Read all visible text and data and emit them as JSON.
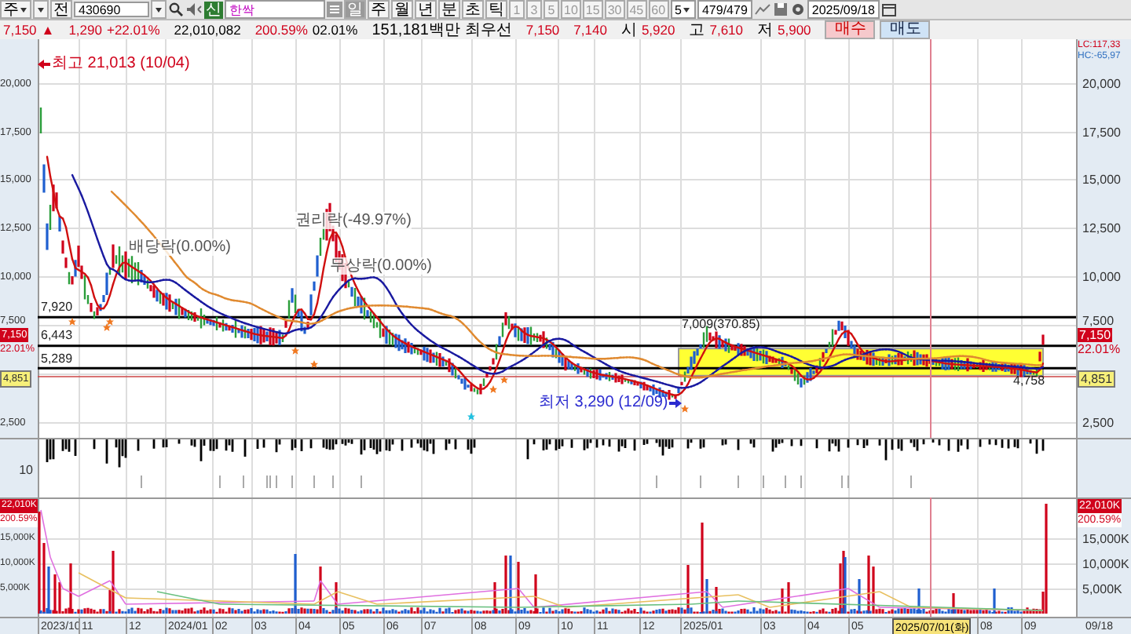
{
  "toolbar": {
    "market": "주",
    "scope": "전",
    "code": "430690",
    "badge": "신",
    "name": "한싹",
    "periods": [
      {
        "label": "일",
        "selected": true
      },
      {
        "label": "주",
        "selected": false
      },
      {
        "label": "월",
        "selected": false
      },
      {
        "label": "년",
        "selected": false
      },
      {
        "label": "분",
        "selected": false
      },
      {
        "label": "초",
        "selected": false
      },
      {
        "label": "틱",
        "selected": false
      }
    ],
    "intervals": [
      "1",
      "3",
      "5",
      "10",
      "15",
      "30",
      "45",
      "60"
    ],
    "count_select": "5",
    "count": "479/479",
    "date": "2025/09/18"
  },
  "quote": {
    "price": "7,150",
    "arrow": "▲",
    "change": "1,290",
    "change_pct": "+22.01%",
    "volume": "22,010,082",
    "volume_ratio": "200.59%",
    "turnover": "02.01%",
    "amount": "151,181백만",
    "best_label": "최우선",
    "ask": "7,150",
    "bid": "7,140",
    "open_label": "시",
    "open": "5,920",
    "high_label": "고",
    "high": "7,610",
    "low_label": "저",
    "low": "5,900",
    "buy_button": "매수",
    "sell_button": "매도"
  },
  "price_pane": {
    "left_axis": [
      "20,000",
      "17,500",
      "15,000",
      "12,500",
      "10,000",
      "7,500",
      "2,500"
    ],
    "right_axis": [
      "20,000",
      "17,500",
      "15,000",
      "12,500",
      "10,000",
      "7,500",
      "2,500"
    ],
    "right_header": [
      "LC:117,33",
      "HC:-65,97"
    ],
    "left_tags": {
      "price_tag": "7,150",
      "pct_tag": "22.01%",
      "line_tag": "4,851"
    },
    "right_tags": {
      "price_tag": "7,150",
      "pct_tag": "22.01%",
      "line_tag": "4,851"
    },
    "annotations": [
      {
        "text": "최고 21,013 (10/04)",
        "kind": "high"
      },
      {
        "text": "배당락(0.00%)",
        "kind": "event"
      },
      {
        "text": "권리락(-49.97%)",
        "kind": "event"
      },
      {
        "text": "무상락(0.00%)",
        "kind": "event"
      },
      {
        "text": "7,920",
        "kind": "level"
      },
      {
        "text": "6,443",
        "kind": "level"
      },
      {
        "text": "5,289",
        "kind": "level"
      },
      {
        "text": "7,009(370.85)",
        "kind": "level"
      },
      {
        "text": "최저 3,290 (12/09)",
        "kind": "low"
      },
      {
        "text": "4,758",
        "kind": "level"
      }
    ]
  },
  "indicator_pane": {
    "left_axis": [
      "10"
    ]
  },
  "volume_pane": {
    "left_tags": {
      "volume_tag": "22,010K",
      "pct_tag": "200.59%"
    },
    "right_tags": {
      "volume_tag": "22,010K",
      "pct_tag": "200.59%"
    },
    "left_axis": [
      "15,000K",
      "10,000K",
      "5,000K"
    ],
    "right_axis": [
      "15,000K",
      "10,000K",
      "5,000K"
    ]
  },
  "date_axis": {
    "labels": [
      {
        "label": "2023/10",
        "selected": false
      },
      {
        "label": "11",
        "selected": false
      },
      {
        "label": "12",
        "selected": false
      },
      {
        "label": "2024/01",
        "selected": false
      },
      {
        "label": "02",
        "selected": false
      },
      {
        "label": "03",
        "selected": false
      },
      {
        "label": "04",
        "selected": false
      },
      {
        "label": "05",
        "selected": false
      },
      {
        "label": "06",
        "selected": false
      },
      {
        "label": "07",
        "selected": false
      },
      {
        "label": "08",
        "selected": false
      },
      {
        "label": "09",
        "selected": false
      },
      {
        "label": "10",
        "selected": false
      },
      {
        "label": "11",
        "selected": false
      },
      {
        "label": "12",
        "selected": false
      },
      {
        "label": "2025/01",
        "selected": false
      },
      {
        "label": "03",
        "selected": false
      },
      {
        "label": "04",
        "selected": false
      },
      {
        "label": "05",
        "selected": false
      },
      {
        "label": "2025/07/01(화)",
        "selected": true
      },
      {
        "label": "08",
        "selected": false
      },
      {
        "label": "09",
        "selected": false
      }
    ],
    "end_label": "09/18"
  }
}
